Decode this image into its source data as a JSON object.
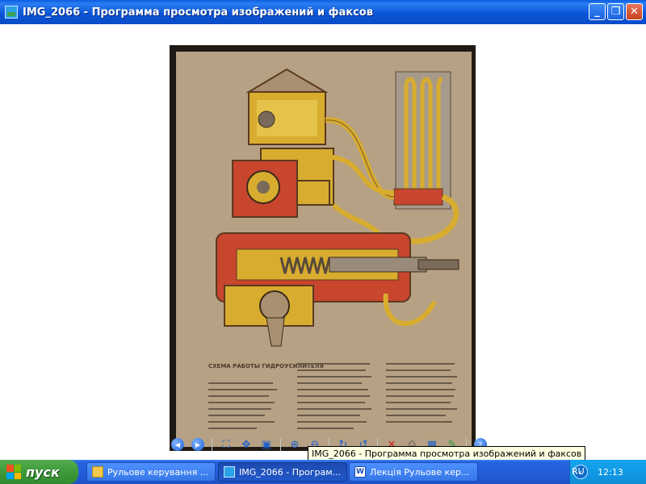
{
  "window": {
    "title": "IMG_2066 - Программа просмотра изображений и факсов",
    "buttons": {
      "minimize": "_",
      "maximize": "❐",
      "close": "✕"
    }
  },
  "toolbar": {
    "tooltip": "IMG_2066 - Программа просмотра изображений и факсов",
    "icons": [
      "previous-image",
      "next-image",
      "best-fit",
      "actual-size",
      "slideshow",
      "zoom-in",
      "zoom-out",
      "rotate-clockwise",
      "rotate-counterclockwise",
      "delete",
      "print",
      "save",
      "edit",
      "help"
    ]
  },
  "taskbar": {
    "start_label": "пуск",
    "tasks": [
      {
        "label": "Рульове керування ..."
      },
      {
        "label": "IMG_2066 - Програм..."
      },
      {
        "label": "Лекція Рульове кер..."
      }
    ],
    "language": "RU",
    "clock": "12:13"
  },
  "photo": {
    "heading": "СХЕМА РАБОТЫ ГИДРОУСИЛИТЕЛЯ"
  },
  "colors": {
    "titlebar": "#0a4bc7",
    "taskbar": "#245edb",
    "start": "#3f9a3c",
    "paper": "#b6a184",
    "hydraulic_red": "#c8452e",
    "oil_yellow": "#d8ad2f"
  }
}
